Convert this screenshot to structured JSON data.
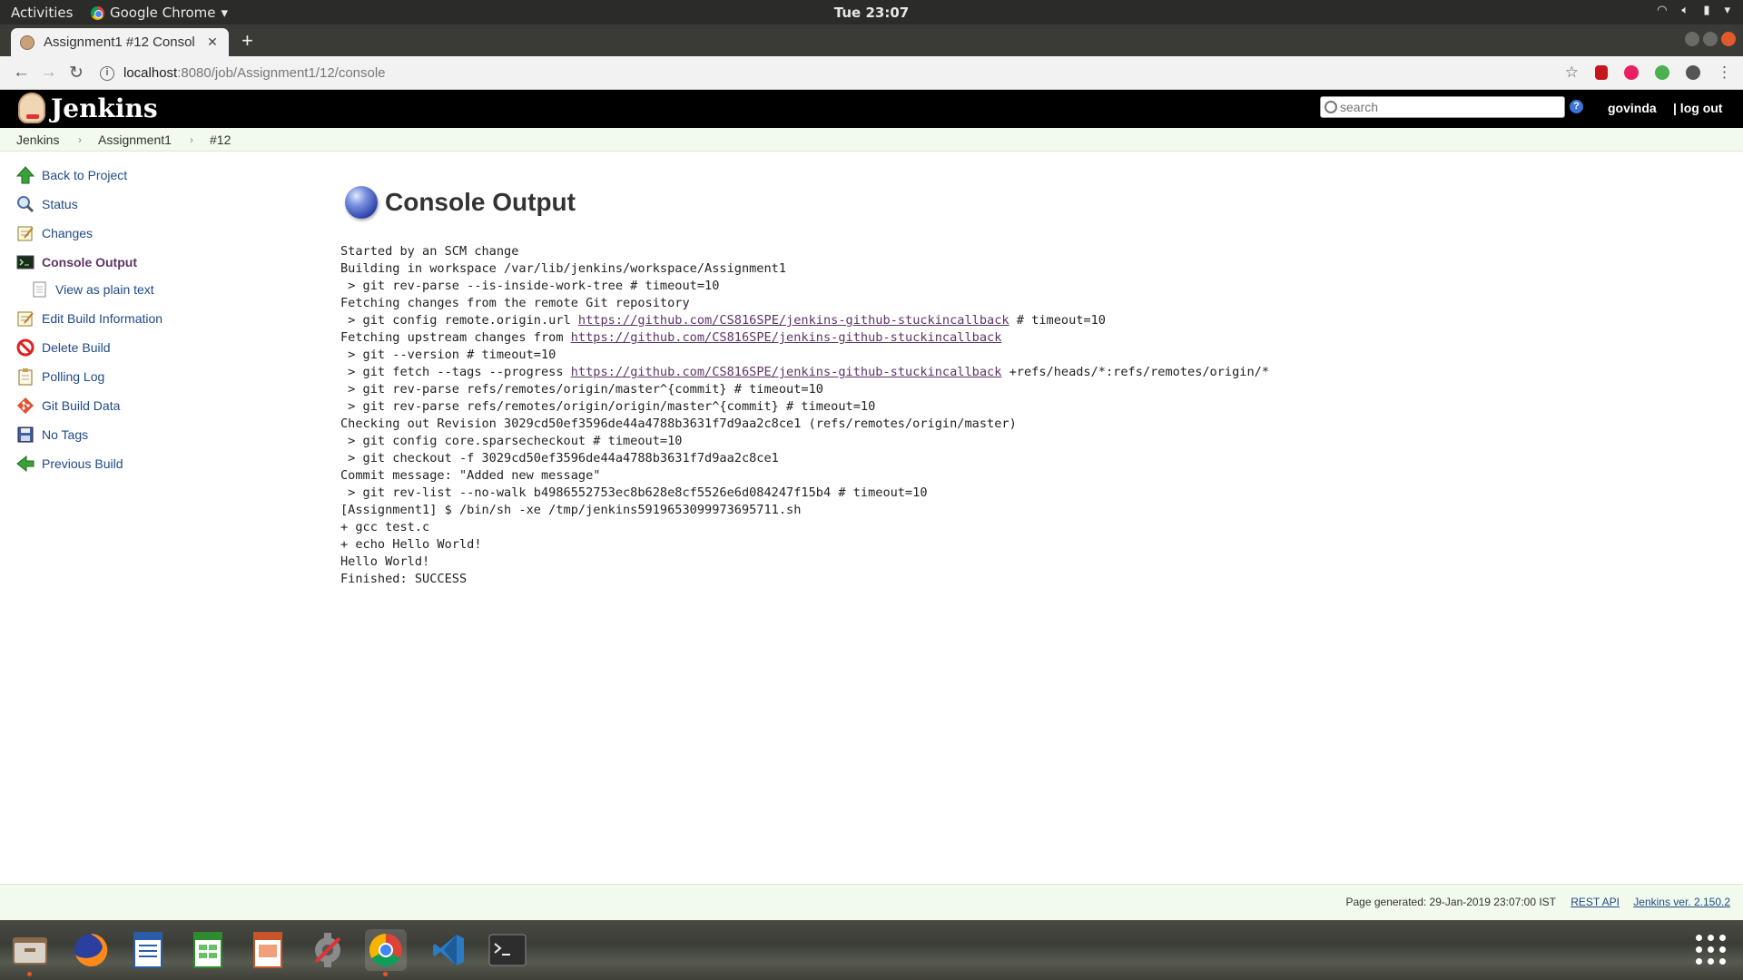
{
  "desktop": {
    "activities": "Activities",
    "app_name": "Google Chrome",
    "clock": "Tue 23:07"
  },
  "browser": {
    "tab_title": "Assignment1 #12 Consol",
    "url_host": "localhost",
    "url_path": ":8080/job/Assignment1/12/console"
  },
  "jenkins": {
    "logo_text": "Jenkins",
    "search_placeholder": "search",
    "username": "govinda",
    "logout": "| log out"
  },
  "breadcrumb": [
    "Jenkins",
    "Assignment1",
    "#12"
  ],
  "sidebar": {
    "items": [
      {
        "label": "Back to Project",
        "icon": "up-arrow-icon"
      },
      {
        "label": "Status",
        "icon": "magnifier-icon"
      },
      {
        "label": "Changes",
        "icon": "notepad-icon"
      },
      {
        "label": "Console Output",
        "icon": "terminal-icon"
      },
      {
        "label": "View as plain text",
        "icon": "document-icon"
      },
      {
        "label": "Edit Build Information",
        "icon": "notepad-icon"
      },
      {
        "label": "Delete Build",
        "icon": "no-entry-icon"
      },
      {
        "label": "Polling Log",
        "icon": "clipboard-icon"
      },
      {
        "label": "Git Build Data",
        "icon": "git-icon"
      },
      {
        "label": "No Tags",
        "icon": "save-icon"
      },
      {
        "label": "Previous Build",
        "icon": "left-arrow-icon"
      }
    ]
  },
  "main": {
    "title": "Console Output",
    "console": {
      "l1": "Started by an SCM change",
      "l2": "Building in workspace /var/lib/jenkins/workspace/Assignment1",
      "l3": " > git rev-parse --is-inside-work-tree # timeout=10",
      "l4": "Fetching changes from the remote Git repository",
      "l5_pre": " > git config remote.origin.url ",
      "l5_link": "https://github.com/CS816SPE/jenkins-github-stuckincallback",
      "l5_post": " # timeout=10",
      "l6_pre": "Fetching upstream changes from ",
      "l6_link": "https://github.com/CS816SPE/jenkins-github-stuckincallback",
      "l7": " > git --version # timeout=10",
      "l8_pre": " > git fetch --tags --progress ",
      "l8_link": "https://github.com/CS816SPE/jenkins-github-stuckincallback",
      "l8_post": " +refs/heads/*:refs/remotes/origin/*",
      "l9": " > git rev-parse refs/remotes/origin/master^{commit} # timeout=10",
      "l10": " > git rev-parse refs/remotes/origin/origin/master^{commit} # timeout=10",
      "l11": "Checking out Revision 3029cd50ef3596de44a4788b3631f7d9aa2c8ce1 (refs/remotes/origin/master)",
      "l12": " > git config core.sparsecheckout # timeout=10",
      "l13": " > git checkout -f 3029cd50ef3596de44a4788b3631f7d9aa2c8ce1",
      "l14": "Commit message: \"Added new message\"",
      "l15": " > git rev-list --no-walk b4986552753ec8b628e8cf5526e6d084247f15b4 # timeout=10",
      "l16": "[Assignment1] $ /bin/sh -xe /tmp/jenkins5919653099973695711.sh",
      "l17": "+ gcc test.c",
      "l18": "+ echo Hello World!",
      "l19": "Hello World!",
      "l20": "Finished: SUCCESS"
    }
  },
  "footer": {
    "generated": "Page generated: 29-Jan-2019 23:07:00 IST",
    "rest_api": "REST API",
    "version": "Jenkins ver. 2.150.2"
  },
  "taskbar": [
    "file-manager-icon",
    "firefox-icon",
    "writer-icon",
    "calc-icon",
    "impress-icon",
    "settings-icon",
    "chrome-icon",
    "vscode-icon",
    "terminal-icon"
  ],
  "colors": {
    "header_bg": "#000000",
    "breadcrumb_bg": "#f1faec",
    "link": "#204a87",
    "visited_link": "#5c3566"
  }
}
